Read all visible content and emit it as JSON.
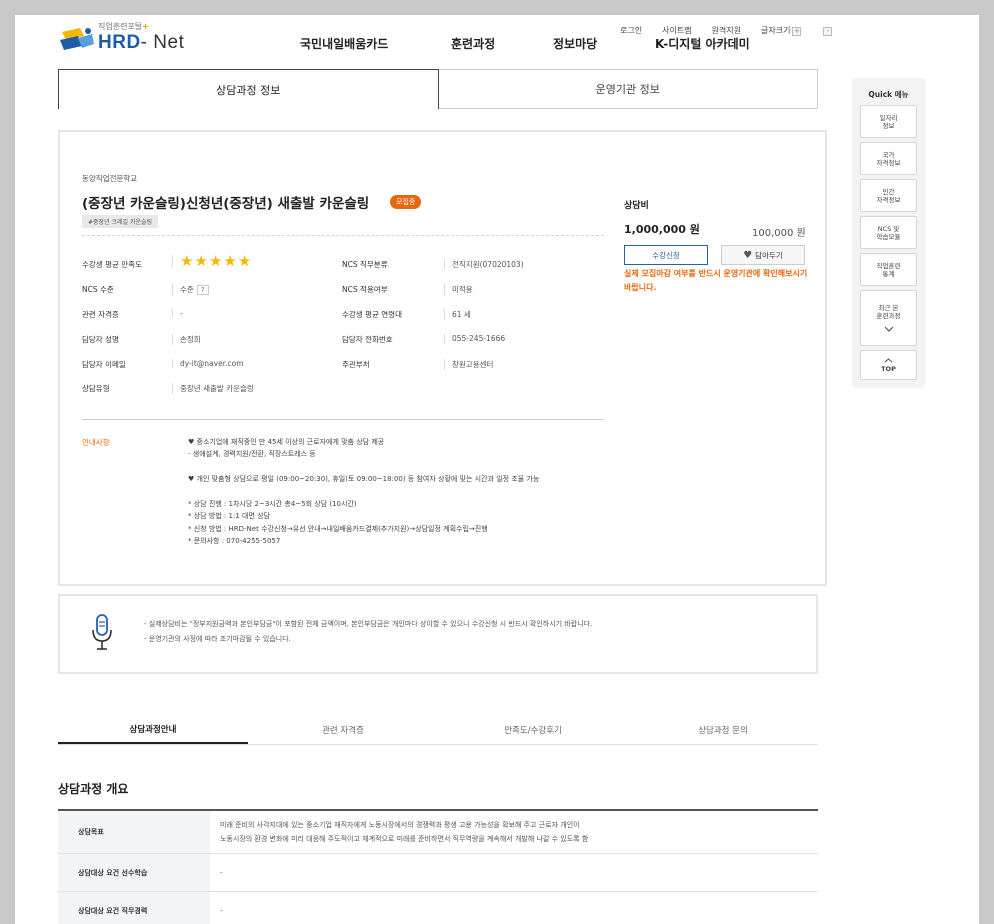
{
  "header": {
    "util_links": [
      "로그인",
      "사이트맵",
      "원격지원",
      "글자크기"
    ],
    "font_plus": "+",
    "font_minus": "-",
    "logo_sub": "직업훈련포털",
    "logo_plus": "+",
    "logo_hrd": "HRD",
    "logo_net": "- Net",
    "gnb": [
      "국민내일배움카드",
      "훈련과정",
      "정보마당",
      "K-디지털 아카데미"
    ]
  },
  "top_tabs": [
    "상담과정 정보",
    "운영기관 정보"
  ],
  "course": {
    "school": "동양직업전문학교",
    "title": "(중장년 카운슬링)신청년(중장년) 새출발 카운슬링",
    "status_badge": "모집중",
    "tag": "#중장년 크레길 카운슬링",
    "rating": 5,
    "rating_max": 5,
    "fields": {
      "satisfaction_label": "수강생 평균 만족도",
      "ncs_category_label": "NCS 직무분류",
      "ncs_category_value": "전직지원(07020103)",
      "ncs_level_label": "NCS 수준",
      "ncs_level_value": "수준",
      "ncs_level_help": "?",
      "ncs_apply_label": "NCS 적용여부",
      "ncs_apply_value": "미적용",
      "cert_label": "관련 자격증",
      "cert_value": "-",
      "age_label": "수강생 평균 연령대",
      "age_value": "61 세",
      "manager_label": "담당자 성명",
      "manager_value": "손정희",
      "phone_label": "담당자 전화번호",
      "phone_value": "055-245-1666",
      "email_label": "담당자 이메일",
      "email_value": "dy-it@naver.com",
      "dept_label": "주관부처",
      "dept_value": "창원고용센터",
      "type_label": "상담유형",
      "type_value": "중장년 새출발 카운슬링"
    },
    "guide_label": "안내사항",
    "guide_lines": [
      "♥ 중소기업에 재직중인 만 45세 이상의 근로자에게 맞춤 상담 제공",
      "- 생애설계, 경력지원/전환, 직장스트레스 등",
      "",
      "♥ 개인 맞춤형 상담으로 평일 (09:00~20:30), 휴일(토 09:00~18:00) 등 참여자 상황에 맞는 시간과 일정 조율 가능",
      "",
      "* 상담 진행 : 1차시당 2~3시간 총4~5회 상담 (10시간)",
      "* 상담 방법 : 1:1 대면 상담",
      "* 신청 방법 : HRD-Net 수강신청→유선 안내→내일배움카드결제(추가지원)→상담일정 계획수립→진행",
      "* 문의사항 : 070-4255-5057"
    ]
  },
  "price": {
    "label": "상담비",
    "main": "1,000,000 원",
    "self_pay": "100,000 원",
    "apply_button": "수강신청",
    "save_button": "담아두기",
    "warning": "실제 모집마감 여부를 반드시 운영기관에 확인해보시기 바랍니다."
  },
  "quick_menu": {
    "title": "Quick 메뉴",
    "items": [
      "일자리\n정보",
      "국가\n자격정보",
      "민간\n자격정보",
      "NCS 및\n학습모듈",
      "직업훈련\n통계",
      "최근 본\n훈련과정"
    ],
    "top": "TOP"
  },
  "notice": {
    "lines": [
      "- 실제상담비는 \"정부지원금액과 본인부담금\"이 포함된 전체 금액이며, 본인부담금은 개인마다 상이할 수 있으니 수강신청 시 반드시 확인하시기 바랍니다.",
      "- 운영기관의 사정에 따라 조기마감될 수 있습니다."
    ]
  },
  "bottom_tabs": [
    "상담과정안내",
    "관련 자격증",
    "만족도/수강후기",
    "상담과정 문의"
  ],
  "overview": {
    "title": "상담과정 개요",
    "rows": [
      {
        "head": "상담목표",
        "value": "미래 준비의 사각지대에 있는 중소기업 재직자에게 노동시장에서의 경쟁력과 평생 고용 가능성을 확보해 주고 근로자 개인이\n노동시장의 환경 변화에 미리 대응해 주도적이고 체계적으로 미래를 준비하면서 직무역량을 계속해서 개발해 나갈 수 있도록 함"
      },
      {
        "head": "상담대상 요건 선수학습",
        "value": "-"
      },
      {
        "head": "상담대상 요건 직무경력",
        "value": "-"
      }
    ]
  },
  "colors": {
    "accent_orange": "#e8680e",
    "brand_blue": "#1f5ca8",
    "star": "#f2b90c"
  }
}
